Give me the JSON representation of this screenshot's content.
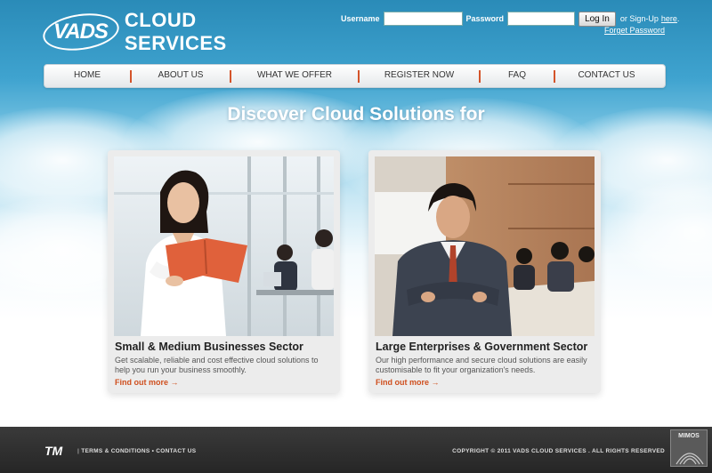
{
  "brand": {
    "logo_mark": "VADS",
    "logo_text": "CLOUD SERVICES"
  },
  "login": {
    "username_label": "Username",
    "username_value": "",
    "password_label": "Password",
    "password_value": "",
    "login_button": "Log In",
    "signup_prefix": "or Sign-Up",
    "signup_link": "here",
    "signup_suffix": ".",
    "forget_password": "Forget Password"
  },
  "nav": {
    "items": [
      {
        "label": "HOME"
      },
      {
        "label": "ABOUT US"
      },
      {
        "label": "WHAT WE OFFER"
      },
      {
        "label": "REGISTER NOW"
      },
      {
        "label": "FAQ"
      },
      {
        "label": "CONTACT US"
      }
    ]
  },
  "headline": "Discover Cloud Solutions for",
  "cards": [
    {
      "title": "Small & Medium Businesses Sector",
      "description": "Get scalable, reliable and cost effective cloud solutions to help you run your business smoothly.",
      "link": "Find out more →"
    },
    {
      "title": "Large Enterprises & Government Sector",
      "description": "Our high performance and secure cloud solutions are easily customisable to fit your organization's needs.",
      "link": "Find out more →"
    }
  ],
  "footer": {
    "tm_logo": "TM",
    "terms": "TERMS & CONDITIONS",
    "separator": "•",
    "contact": "CONTACT US",
    "copyright": "COPYRIGHT © 2011 VADS CLOUD SERVICES . ALL RIGHTS RESERVED",
    "mimos": "MIMOS"
  },
  "colors": {
    "accent": "#cf4f1e",
    "sky_top": "#2a8bb8",
    "footer_bg": "#2e2e2e"
  }
}
